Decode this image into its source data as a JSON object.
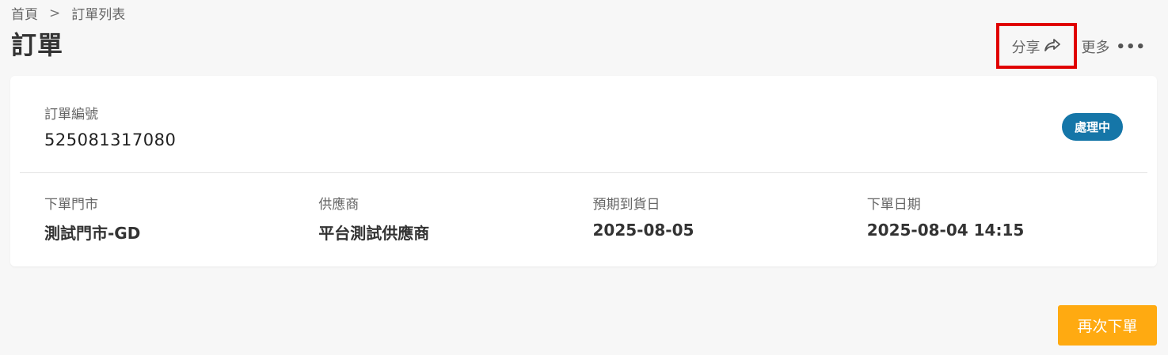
{
  "breadcrumb": {
    "home": "首頁",
    "separator": ">",
    "current": "訂單列表"
  },
  "page": {
    "title": "訂單"
  },
  "actions": {
    "share_label": "分享",
    "share_icon": "share-arrow-icon",
    "more_label": "更多",
    "more_icon": "ellipsis-icon",
    "more_dots": "•••"
  },
  "order": {
    "number_label": "訂單編號",
    "number_value": "525081317080",
    "status": "處理中",
    "status_color": "#1576a8",
    "fields": [
      {
        "label": "下單門市",
        "value": "測試門市-GD"
      },
      {
        "label": "供應商",
        "value": "平台測試供應商"
      },
      {
        "label": "預期到貨日",
        "value": "2025-08-05"
      },
      {
        "label": "下單日期",
        "value": "2025-08-04 14:15"
      }
    ]
  },
  "footer": {
    "reorder_label": "再次下單",
    "reorder_color": "#ffaa11"
  },
  "highlight_color": "#e00000"
}
